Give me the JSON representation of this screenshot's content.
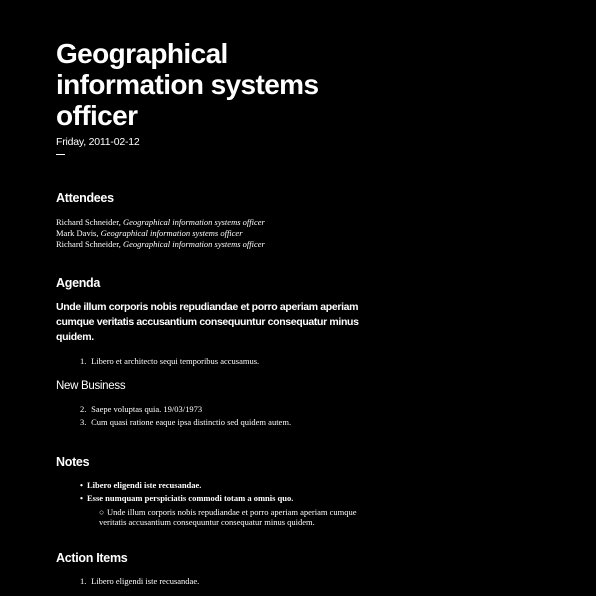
{
  "title": "Geographical information systems officer",
  "date": "Friday, 2011-02-12",
  "attendees": {
    "heading": "Attendees",
    "people": [
      {
        "name": "Richard Schneider",
        "role": "Geographical information systems officer"
      },
      {
        "name": "Mark Davis",
        "role": "Geographical information systems officer"
      },
      {
        "name": "Richard Schneider",
        "role": "Geographical information systems officer"
      }
    ]
  },
  "agenda": {
    "heading": "Agenda",
    "lead": "Unde illum corporis nobis repudiandae et porro aperiam aperiam cumque veritatis accusantium consequuntur consequatur minus quidem.",
    "items": [
      {
        "num": "1.",
        "text": "Libero et architecto sequi temporibus accusamus."
      }
    ],
    "new_business": {
      "heading": "New Business",
      "items": [
        {
          "num": "2.",
          "text": "Saepe voluptas quia. 19/03/1973"
        },
        {
          "num": "3.",
          "text": "Cum quasi ratione eaque ipsa distinctio sed quidem autem."
        }
      ]
    }
  },
  "notes": {
    "heading": "Notes",
    "items": [
      {
        "text": "Libero eligendi iste recusandae."
      },
      {
        "text": "Esse numquam perspiciatis commodi totam a omnis quo."
      }
    ],
    "sub_items": [
      {
        "text": "Unde illum corporis nobis repudiandae et porro aperiam aperiam cumque veritatis accusantium consequuntur consequatur minus quidem."
      }
    ]
  },
  "action_items": {
    "heading": "Action Items",
    "items": [
      {
        "num": "1.",
        "text": "Libero eligendi iste recusandae."
      }
    ]
  }
}
